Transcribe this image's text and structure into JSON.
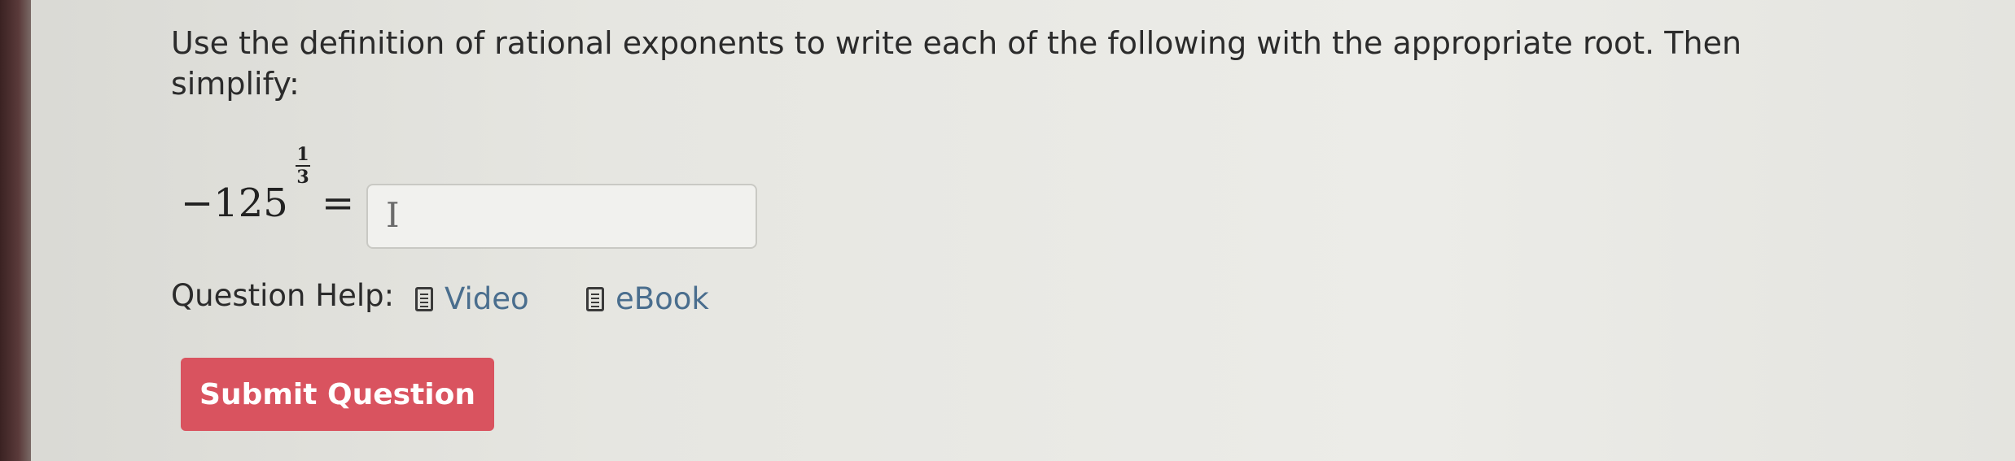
{
  "question": {
    "prompt": "Use the definition of rational exponents to write each of the following with the appropriate root. Then simplify:",
    "expression": {
      "base": "−125",
      "exponent_numerator": "1",
      "exponent_denominator": "3",
      "equals": "="
    },
    "answer": {
      "value": "",
      "cursor_glyph": "I"
    }
  },
  "help": {
    "label": "Question Help:",
    "links": [
      {
        "label": "Video",
        "icon": "document-icon"
      },
      {
        "label": "eBook",
        "icon": "document-icon"
      }
    ]
  },
  "actions": {
    "submit_label": "Submit Question"
  },
  "colors": {
    "submit_bg": "#d9535f",
    "link": "#4a6e8e"
  }
}
